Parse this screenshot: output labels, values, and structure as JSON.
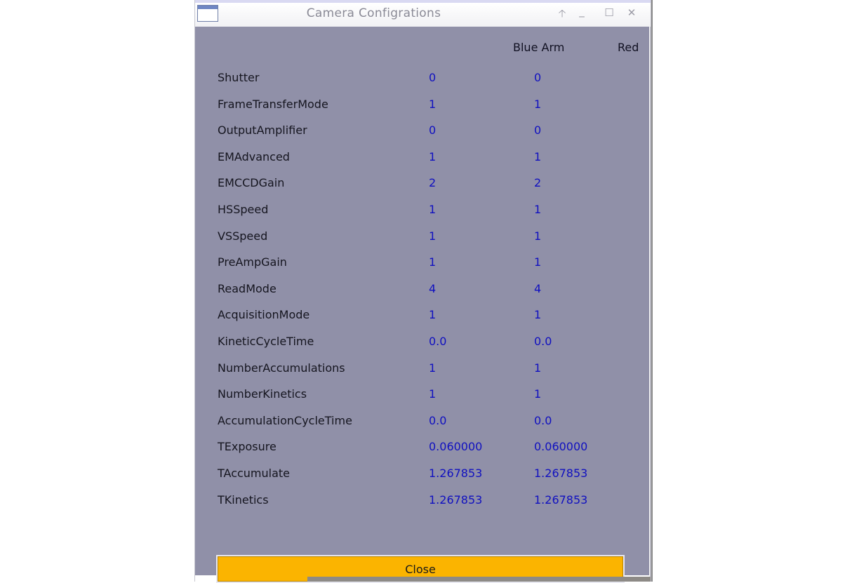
{
  "window": {
    "title": "Camera Configrations",
    "buttons": {
      "pin": "🡡",
      "minimize": "_",
      "maximize": "☐",
      "close": "✕"
    }
  },
  "columns": {
    "blue": "Blue Arm",
    "red": "Red"
  },
  "rows": [
    {
      "label": "Shutter",
      "blue": "0",
      "red": "0"
    },
    {
      "label": "FrameTransferMode",
      "blue": "1",
      "red": "1"
    },
    {
      "label": "OutputAmplifier",
      "blue": "0",
      "red": "0"
    },
    {
      "label": "EMAdvanced",
      "blue": "1",
      "red": "1"
    },
    {
      "label": "EMCCDGain",
      "blue": "2",
      "red": "2"
    },
    {
      "label": "HSSpeed",
      "blue": "1",
      "red": "1"
    },
    {
      "label": "VSSpeed",
      "blue": "1",
      "red": "1"
    },
    {
      "label": "PreAmpGain",
      "blue": "1",
      "red": "1"
    },
    {
      "label": "ReadMode",
      "blue": "4",
      "red": "4"
    },
    {
      "label": "AcquisitionMode",
      "blue": "1",
      "red": "1"
    },
    {
      "label": "KineticCycleTime",
      "blue": "0.0",
      "red": "0.0"
    },
    {
      "label": "NumberAccumulations",
      "blue": "1",
      "red": "1"
    },
    {
      "label": "NumberKinetics",
      "blue": "1",
      "red": "1"
    },
    {
      "label": "AccumulationCycleTime",
      "blue": "0.0",
      "red": "0.0"
    },
    {
      "label": "TExposure",
      "blue": "0.060000",
      "red": "0.060000"
    },
    {
      "label": "TAccumulate",
      "blue": "1.267853",
      "red": "1.267853"
    },
    {
      "label": "TKinetics",
      "blue": "1.267853",
      "red": "1.267853"
    }
  ],
  "close_button": "Close",
  "colors": {
    "panel": "#9090a8",
    "value_text": "#1010c0",
    "close_button": "#fbb400"
  }
}
